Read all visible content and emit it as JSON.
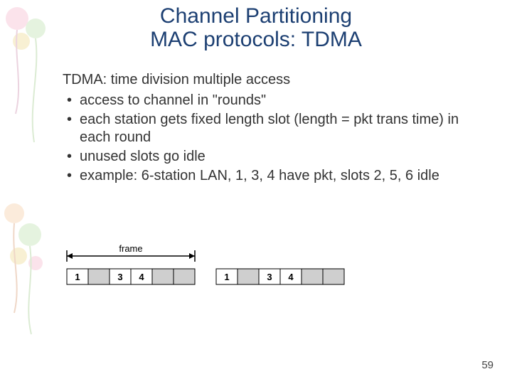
{
  "title_line1": "Channel Partitioning",
  "title_line2": "MAC protocols: TDMA",
  "subheading": "TDMA: time division multiple access",
  "bullets": [
    "access to channel in \"rounds\"",
    "each station gets fixed length slot (length = pkt trans time) in each round",
    "unused slots go idle",
    "example: 6-station LAN, 1, 3, 4 have pkt, slots 2, 5, 6 idle"
  ],
  "diagram": {
    "label": "frame",
    "frame1_slots": [
      {
        "num": "1",
        "filled": true
      },
      {
        "num": "",
        "filled": false
      },
      {
        "num": "3",
        "filled": true
      },
      {
        "num": "4",
        "filled": true
      },
      {
        "num": "",
        "filled": false
      },
      {
        "num": "",
        "filled": false
      }
    ],
    "frame2_slots": [
      {
        "num": "1",
        "filled": true
      },
      {
        "num": "",
        "filled": false
      },
      {
        "num": "3",
        "filled": true
      },
      {
        "num": "4",
        "filled": true
      },
      {
        "num": "",
        "filled": false
      },
      {
        "num": "",
        "filled": false
      }
    ]
  },
  "page_number": "59"
}
